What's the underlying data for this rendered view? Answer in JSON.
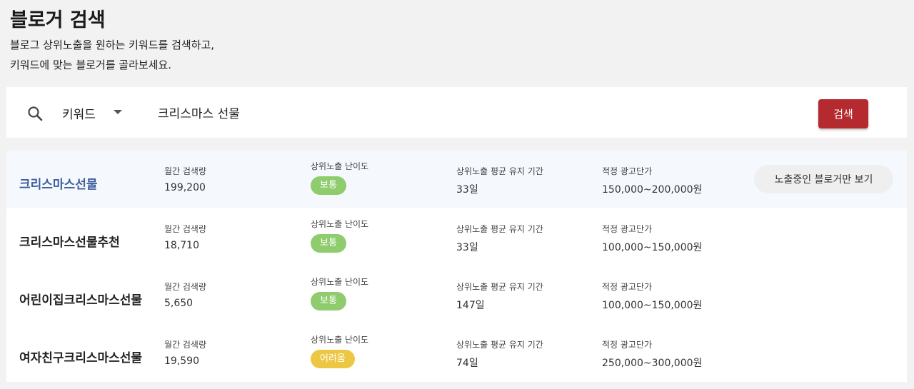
{
  "header": {
    "title": "블로거 검색",
    "desc_line1": "블로그 상위노출을 원하는 키워드를 검색하고,",
    "desc_line2": "키워드에 맞는 블로거를 골라보세요."
  },
  "search": {
    "type_label": "키워드",
    "query": "크리스마스 선물",
    "button_label": "검색"
  },
  "columns": {
    "monthly": "월간 검색량",
    "difficulty": "상위노출 난이도",
    "duration": "상위노출 평균 유지 기간",
    "ad_price": "적정 광고단가"
  },
  "filter_button_label": "노출중인 블로거만 보기",
  "rows": [
    {
      "keyword": "크리스마스선물",
      "monthly": "199,200",
      "difficulty": "보통",
      "difficulty_color": "#8fcc6e",
      "duration": "33일",
      "ad_price": "150,000~200,000원"
    },
    {
      "keyword": "크리스마스선물추천",
      "monthly": "18,710",
      "difficulty": "보통",
      "difficulty_color": "#8fcc6e",
      "duration": "33일",
      "ad_price": "100,000~150,000원"
    },
    {
      "keyword": "어린이집크리스마스선물",
      "monthly": "5,650",
      "difficulty": "보통",
      "difficulty_color": "#8fcc6e",
      "duration": "147일",
      "ad_price": "100,000~150,000원"
    },
    {
      "keyword": "여자친구크리스마스선물",
      "monthly": "19,590",
      "difficulty": "어려움",
      "difficulty_color": "#edc743",
      "duration": "74일",
      "ad_price": "250,000~300,000원"
    }
  ],
  "colors": {
    "accent": "#b52a2e",
    "highlight_link": "#3e5ea0",
    "highlight_row_bg": "#f5f9fe"
  }
}
